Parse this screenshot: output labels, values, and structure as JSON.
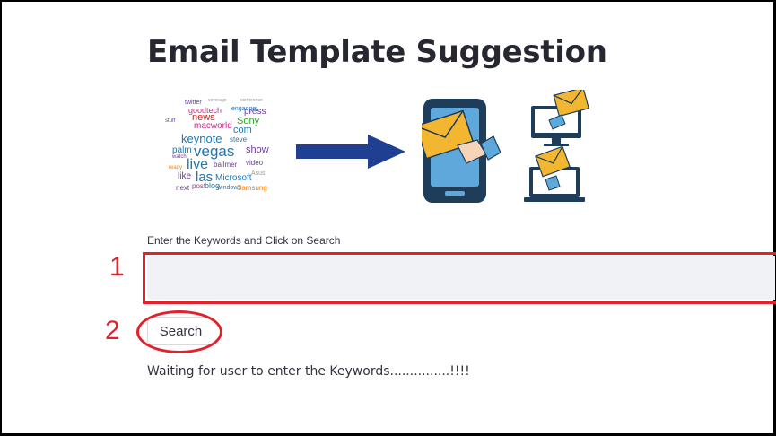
{
  "app": {
    "title": "Email Template Suggestion"
  },
  "word_cloud": {
    "words": [
      {
        "t": "twitter",
        "c": "#6a3d9a",
        "s": 7
      },
      {
        "t": "coverage",
        "c": "#999999",
        "s": 5
      },
      {
        "t": "conference",
        "c": "#999999",
        "s": 5
      },
      {
        "t": "goodtech",
        "c": "#cc2a8a",
        "s": 9
      },
      {
        "t": "engadget",
        "c": "#1f78b4",
        "s": 7
      },
      {
        "t": "news",
        "c": "#e31a1c",
        "s": 11
      },
      {
        "t": "press",
        "c": "#6a3d9a",
        "s": 10
      },
      {
        "t": "Sony",
        "c": "#33a02c",
        "s": 11
      },
      {
        "t": "stuff",
        "c": "#6a3d9a",
        "s": 6
      },
      {
        "t": "macworld",
        "c": "#cc2a8a",
        "s": 10
      },
      {
        "t": "com",
        "c": "#1f78b4",
        "s": 11
      },
      {
        "t": "keynote",
        "c": "#1f78b4",
        "s": 13
      },
      {
        "t": "steve",
        "c": "#1f78b4",
        "s": 8
      },
      {
        "t": "show",
        "c": "#6a3d9a",
        "s": 11
      },
      {
        "t": "palm",
        "c": "#1f78b4",
        "s": 10
      },
      {
        "t": "vegas",
        "c": "#1f78b4",
        "s": 17
      },
      {
        "t": "live",
        "c": "#1f78b4",
        "s": 16
      },
      {
        "t": "ballmer",
        "c": "#6a3d9a",
        "s": 8
      },
      {
        "t": "video",
        "c": "#6a3d9a",
        "s": 8
      },
      {
        "t": "like",
        "c": "#6a3d9a",
        "s": 10
      },
      {
        "t": "las",
        "c": "#1f78b4",
        "s": 15
      },
      {
        "t": "Microsoft",
        "c": "#1f78b4",
        "s": 10
      },
      {
        "t": "Asus",
        "c": "#999999",
        "s": 7
      },
      {
        "t": "windows",
        "c": "#1f78b4",
        "s": 7
      },
      {
        "t": "post",
        "c": "#cc2a8a",
        "s": 8
      },
      {
        "t": "blog",
        "c": "#1f78b4",
        "s": 9
      },
      {
        "t": "next",
        "c": "#6a3d9a",
        "s": 8
      },
      {
        "t": "Samsung",
        "c": "#ff7f00",
        "s": 8
      },
      {
        "t": "watch",
        "c": "#6a3d9a",
        "s": 6
      },
      {
        "t": "ready",
        "c": "#ff7f00",
        "s": 6
      }
    ]
  },
  "search": {
    "label": "Enter the Keywords and Click on Search",
    "value": "",
    "button_label": "Search"
  },
  "callouts": {
    "one": "1",
    "two": "2",
    "color": "#e3212b"
  },
  "status": {
    "text": "Waiting for user to enter the Keywords...............!!!!"
  },
  "colors": {
    "arrow": "#1f3f93",
    "envelope": "#f2b631",
    "device": "#1e3d5a",
    "screen": "#5fa8dc",
    "input_bg": "#f0f2f6"
  }
}
